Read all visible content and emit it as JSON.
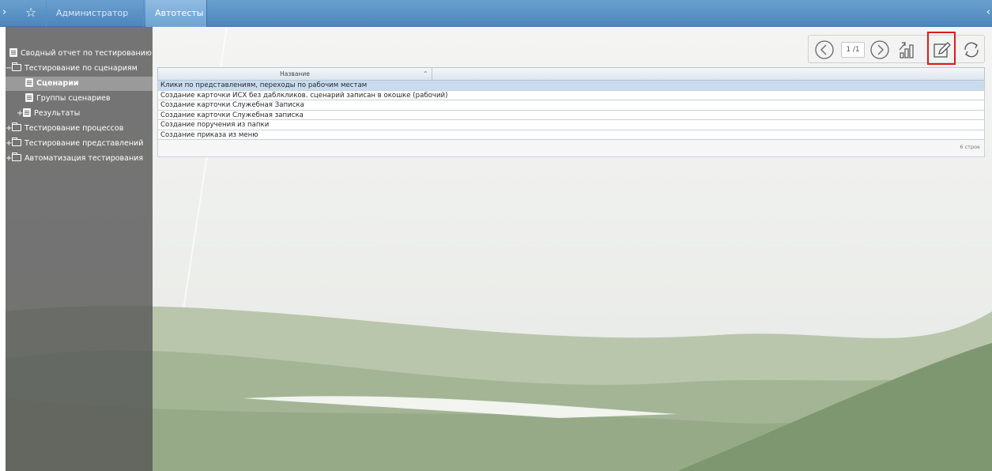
{
  "topbar": {
    "tabs": [
      {
        "label": "Администратор"
      },
      {
        "label": "Автотесты"
      }
    ],
    "icons": {
      "left_edge": "chevron-right-icon",
      "star": "star-icon",
      "right_edge": "chevron-left-icon"
    }
  },
  "sidebar": {
    "items": [
      {
        "label": "Сводный отчет по тестированию",
        "icon": "document-icon",
        "expander": ""
      },
      {
        "label": "Тестирование по сценариям",
        "icon": "folder-open-icon",
        "expander": "−"
      },
      {
        "label": "Сценарии",
        "icon": "document-icon",
        "expander": "",
        "selected": true
      },
      {
        "label": "Группы сценариев",
        "icon": "document-icon",
        "expander": ""
      },
      {
        "label": "Результаты",
        "icon": "document-icon",
        "expander": "+"
      },
      {
        "label": "Тестирование процессов",
        "icon": "folder-icon",
        "expander": "+"
      },
      {
        "label": "Тестирование представлений",
        "icon": "folder-icon",
        "expander": "+"
      },
      {
        "label": "Автоматизация тестирования",
        "icon": "folder-icon",
        "expander": "+"
      }
    ]
  },
  "toolbar": {
    "pager": "1 /1",
    "buttons": [
      "prev-page-icon",
      "next-page-icon",
      "chart-export-icon",
      "edit-icon",
      "refresh-icon"
    ]
  },
  "grid": {
    "columns": [
      "Название"
    ],
    "rows": [
      "Клики по представлениям, переходы по рабочим местам",
      "Создание карточки ИСХ без даблкликов. сценарий записан в окошке (рабочий)",
      "Создание карточки Служебная Записка",
      "Создание карточки Служебная записка",
      "Создание поручения из папки",
      "Создание приказа из меню"
    ],
    "selected_row": 0,
    "row_count": "6 строк"
  },
  "colors": {
    "topbar": "#4d86bd",
    "sidebar": "#585858",
    "highlight": "#e01a1a",
    "selected_row": "#c9dcef"
  }
}
